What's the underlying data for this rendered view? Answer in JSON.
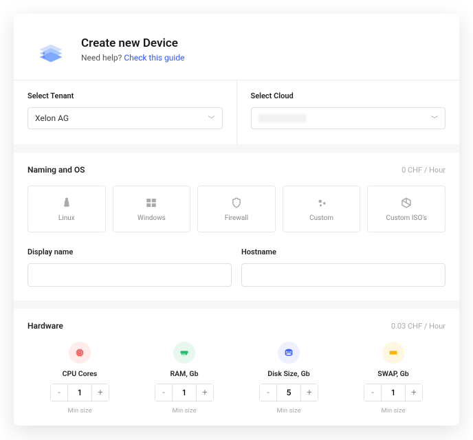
{
  "header": {
    "title": "Create new Device",
    "help_prefix": "Need help? ",
    "help_link": "Check this guide"
  },
  "tenant": {
    "label": "Select Tenant",
    "value": "Xelon AG"
  },
  "cloud": {
    "label": "Select Cloud",
    "value": ""
  },
  "naming": {
    "title": "Naming and OS",
    "price": "0 CHF / Hour",
    "options": [
      {
        "name": "linux",
        "label": "Linux"
      },
      {
        "name": "windows",
        "label": "Windows"
      },
      {
        "name": "firewall",
        "label": "Firewall"
      },
      {
        "name": "custom",
        "label": "Custom"
      },
      {
        "name": "custom-iso",
        "label": "Custom ISO's"
      }
    ],
    "display_name_label": "Display name",
    "display_name_value": "",
    "hostname_label": "Hostname",
    "hostname_value": ""
  },
  "hardware": {
    "title": "Hardware",
    "price": "0.03 CHF / Hour",
    "items": [
      {
        "name": "cpu",
        "label": "CPU Cores",
        "value": 1,
        "min_label": "Min size",
        "color": "#ffeceb",
        "icon_color": "#ff4d4d"
      },
      {
        "name": "ram",
        "label": "RAM, Gb",
        "value": 1,
        "min_label": "Min size",
        "color": "#e8f8ef",
        "icon_color": "#1fbf6b"
      },
      {
        "name": "disk",
        "label": "Disk Size, Gb",
        "value": 5,
        "min_label": "Min size",
        "color": "#ecf0ff",
        "icon_color": "#3f63ff"
      },
      {
        "name": "swap",
        "label": "SWAP, Gb",
        "value": 1,
        "min_label": "Min size",
        "color": "#fff7e0",
        "icon_color": "#ffb300"
      }
    ]
  }
}
